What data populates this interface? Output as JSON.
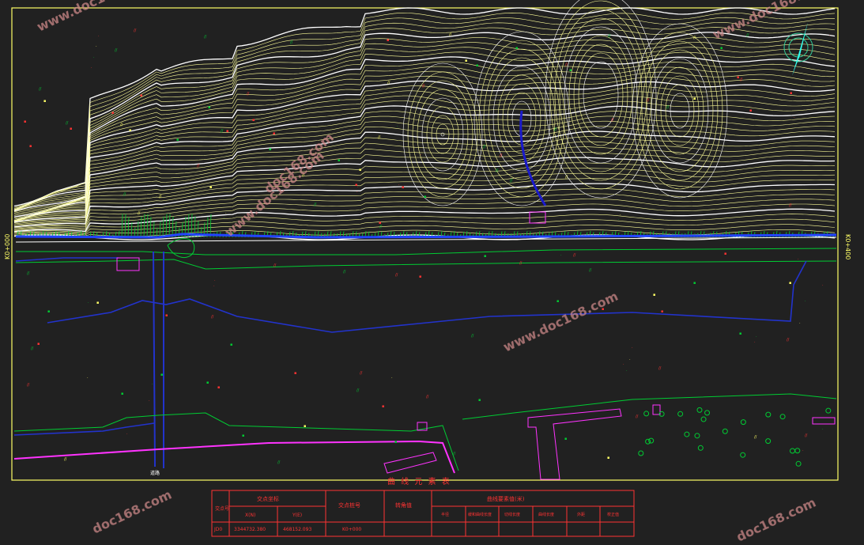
{
  "drawing": {
    "background": "#212121",
    "frame_color": "#ffff66",
    "contour_color": "#ffff99",
    "index_contour_color": "#ffffff",
    "road_color": "#00cc33",
    "river_color": "#1a1acc",
    "boundary_color": "#ff33ff",
    "label_color": "#ff3333",
    "station_left": "K0+000",
    "station_right": "K0+400",
    "curve_table_title": "曲 线 元 素 表",
    "north_arrow": "north-arrow-icon",
    "vertical_road_label": "道路"
  },
  "watermarks": [
    "www.doc168.com",
    "www.doc168.com",
    "www.doc168.com",
    "www.doc168.com",
    "doc168.com",
    "doc168.com",
    "doc168.com",
    "www.doc168.com"
  ],
  "curve_table": {
    "col_point_no": "交点号",
    "col_coords": "交点坐标",
    "col_x": "X(N)",
    "col_y": "Y(E)",
    "col_station": "交点桩号",
    "col_angle": "转角值",
    "col_elements": "曲线要素值(米)",
    "sub_radius": "半径",
    "sub_spiral": "缓和曲线长度",
    "sub_tangent": "切线长度",
    "sub_curve": "曲线长度",
    "sub_external": "外距",
    "sub_correction": "校正值",
    "row": {
      "point_no": "JD0",
      "x": "3344732.380",
      "y": "468152.093",
      "station": "K0+000"
    }
  }
}
